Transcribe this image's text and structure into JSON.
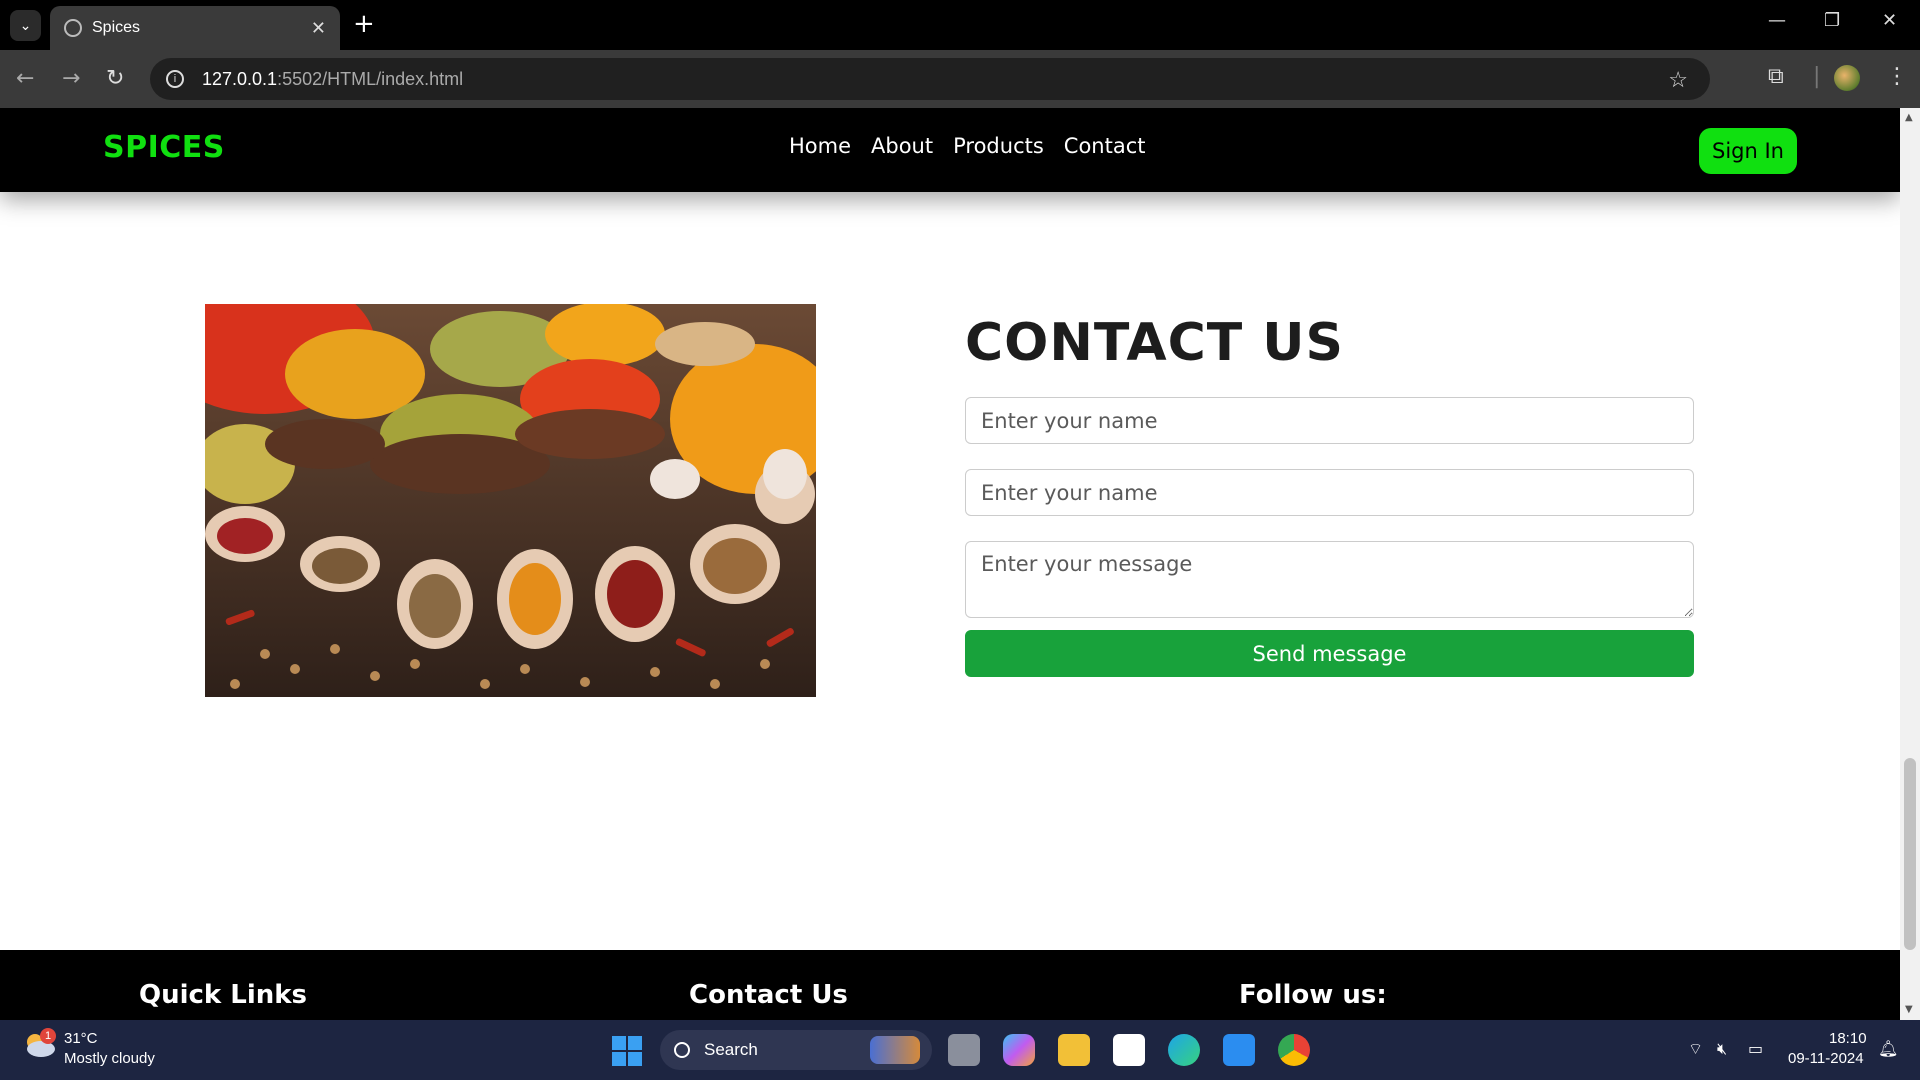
{
  "browser": {
    "tab_title": "Spices",
    "tab_close": "✕",
    "new_tab": "+",
    "url_host": "127.0.0.1",
    "url_rest": ":5502/HTML/index.html",
    "window_minimize": "—",
    "window_restore": "❐",
    "window_close": "✕"
  },
  "site": {
    "logo": "SPICES",
    "nav": [
      "Home",
      "About",
      "Products",
      "Contact"
    ],
    "signin_label": "Sign In",
    "hero_image_alt": "spices",
    "contact": {
      "title": "CONTACT US",
      "name_placeholder": "Enter your name",
      "email_placeholder": "Enter your name",
      "message_placeholder": "Enter your message",
      "send_label": "Send message"
    },
    "footer": {
      "quick_links": "Quick Links",
      "contact_us": "Contact Us",
      "follow_us": "Follow us:"
    }
  },
  "taskbar": {
    "weather_badge": "1",
    "temperature": "31°C",
    "weather": "Mostly cloudy",
    "search_label": "Search",
    "time": "18:10",
    "date": "09-11-2024"
  },
  "colors": {
    "brand_green": "#10e010",
    "send_button": "#18a23b",
    "header_bg": "#000000",
    "taskbar_bg": "#1d2541"
  }
}
